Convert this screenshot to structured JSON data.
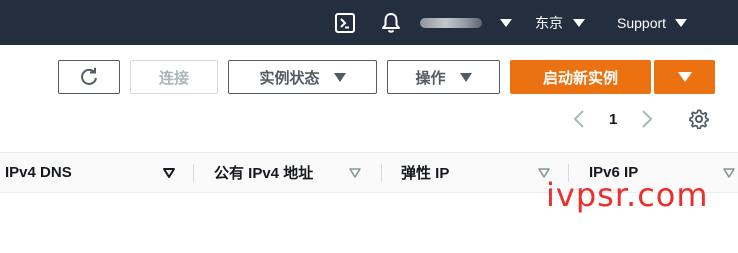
{
  "topbar": {
    "region": "东京",
    "support": "Support",
    "icons": [
      "cloudshell-icon",
      "notifications-bell-icon"
    ]
  },
  "toolbar": {
    "refresh_icon": "refresh-icon",
    "connect": "连接",
    "instance_state": "实例状态",
    "actions": "操作",
    "launch_instances": "启动新实例"
  },
  "pagination": {
    "current_page": "1"
  },
  "table": {
    "columns": [
      {
        "label": "IPv4 DNS",
        "sorted": true
      },
      {
        "label": "公有 IPv4 地址",
        "sorted": false
      },
      {
        "label": "弹性 IP",
        "sorted": false
      },
      {
        "label": "IPv6 IP",
        "sorted": false
      }
    ]
  },
  "watermark": "ivpsr.com",
  "colors": {
    "nav_bg": "#232f3e",
    "primary": "#ec7211",
    "watermark": "#ee2d2d"
  }
}
